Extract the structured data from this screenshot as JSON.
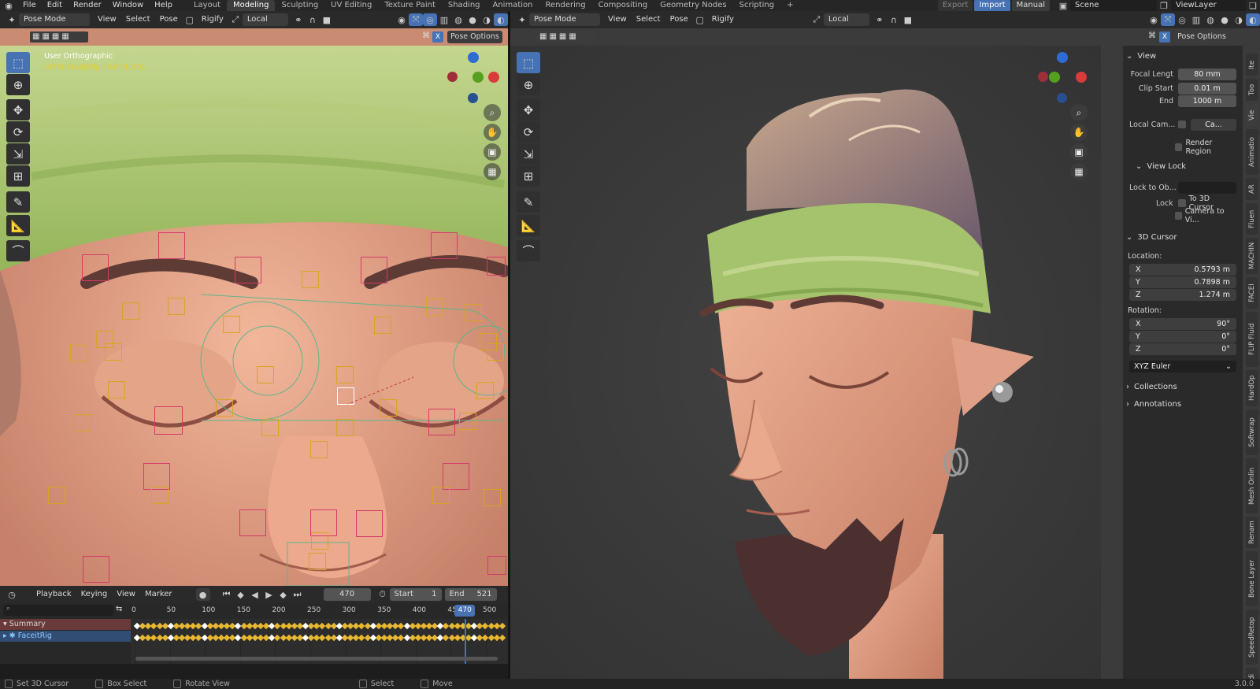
{
  "topbar": {
    "menus": [
      "File",
      "Edit",
      "Render",
      "Window",
      "Help"
    ],
    "workspaces": [
      "Layout",
      "Modeling",
      "Sculpting",
      "UV Editing",
      "Texture Paint",
      "Shading",
      "Animation",
      "Rendering",
      "Compositing",
      "Geometry Nodes",
      "Scripting"
    ],
    "active_workspace": "Modeling",
    "add_tab": "+",
    "export_label": "Export",
    "import_label": "Import",
    "manual_label": "Manual",
    "scene": "Scene",
    "view_layer": "ViewLayer"
  },
  "left_viewport": {
    "mode": "Pose Mode",
    "menus": [
      "View",
      "Select",
      "Pose"
    ],
    "rigify": "Rigify",
    "orientation": "Local",
    "pose_options": "Pose Options",
    "x_label": "X",
    "overlay_title": "User Orthographic",
    "overlay_sub": "(470) FaceitRig : lid.T.L.001"
  },
  "right_viewport": {
    "mode": "Pose Mode",
    "menus": [
      "View",
      "Select",
      "Pose"
    ],
    "rigify": "Rigify",
    "orientation": "Local",
    "pose_options": "Pose Options",
    "x_label": "X"
  },
  "npanel": {
    "view_section": "View",
    "focal_length_label": "Focal Lengt",
    "focal_length": "80 mm",
    "clip_start_label": "Clip Start",
    "clip_start": "0.01 m",
    "clip_end_label": "End",
    "clip_end": "1000 m",
    "local_cam_label": "Local Cam...",
    "local_cam_value": "Ca...",
    "render_region": "Render Region",
    "view_lock_section": "View Lock",
    "lock_to_obj_label": "Lock to Ob...",
    "lock_label": "Lock",
    "to_3d_cursor": "To 3D Cursor",
    "camera_to_view": "Camera to Vi...",
    "cursor_section": "3D Cursor",
    "location_label": "Location:",
    "loc_x": "0.5793 m",
    "loc_y": "0.7898 m",
    "loc_z": "1.274 m",
    "rotation_label": "Rotation:",
    "rot_x": "90°",
    "rot_y": "0°",
    "rot_z": "0°",
    "axis_x": "X",
    "axis_y": "Y",
    "axis_z": "Z",
    "rotation_mode": "XYZ Euler",
    "collections": "Collections",
    "annotations": "Annotations"
  },
  "side_tabs": [
    "Ite",
    "Too",
    "Vie",
    "Animatio",
    "AR",
    "Fluen",
    "MACHIN",
    "FACEI",
    "FLIP Fluid",
    "HardOp",
    "Softwrap",
    "Mesh Onlin",
    "Renam",
    "Bone Layer",
    "SpeedRetop",
    "Edi"
  ],
  "timeline": {
    "playback": "Playback",
    "keying": "Keying",
    "view": "View",
    "marker": "Marker",
    "current_frame": "470",
    "start_label": "Start",
    "start": "1",
    "end_label": "End",
    "end": "521",
    "ruler": [
      "0",
      "50",
      "100",
      "150",
      "200",
      "250",
      "300",
      "350",
      "400",
      "450",
      "500"
    ],
    "playhead": "470",
    "channels": [
      "Summary",
      "FaceitRig"
    ]
  },
  "status": {
    "items": [
      "Set 3D Cursor",
      "Box Select",
      "Rotate View",
      "Select",
      "Move"
    ],
    "version": "3.0.0"
  },
  "colors": {
    "accent": "#4772b3",
    "skin": "#e8a88c",
    "headband": "#a8c26e",
    "bone_red": "#d43a6a",
    "bone_yellow": "#d8a422",
    "keyframe": "#e8b830"
  }
}
